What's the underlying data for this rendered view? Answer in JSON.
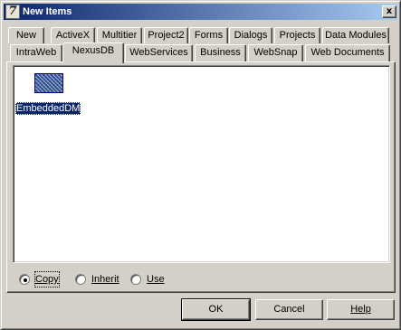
{
  "window": {
    "title": "New Items",
    "app_icon_glyph": "7",
    "close_glyph": "x"
  },
  "tabs": {
    "row_back": [
      "New",
      "ActiveX",
      "Multitier",
      "Project2",
      "Forms",
      "Dialogs",
      "Projects",
      "Data Modules"
    ],
    "row_front": [
      "IntraWeb",
      "NexusDB",
      "WebServices",
      "Business",
      "WebSnap",
      "Web Documents"
    ],
    "selected": "NexusDB"
  },
  "items": [
    {
      "label": "EmbeddedDM",
      "icon": "data-module-icon",
      "selected": true
    }
  ],
  "options": {
    "copy": "Copy",
    "inherit": "Inherit",
    "use": "Use",
    "selected": "Copy"
  },
  "buttons": {
    "ok": "OK",
    "cancel": "Cancel",
    "help": "Help"
  },
  "colors": {
    "titlebar_start": "#0a246a",
    "titlebar_end": "#a6caf0",
    "face": "#d4d0c8",
    "selection": "#0a246a"
  }
}
